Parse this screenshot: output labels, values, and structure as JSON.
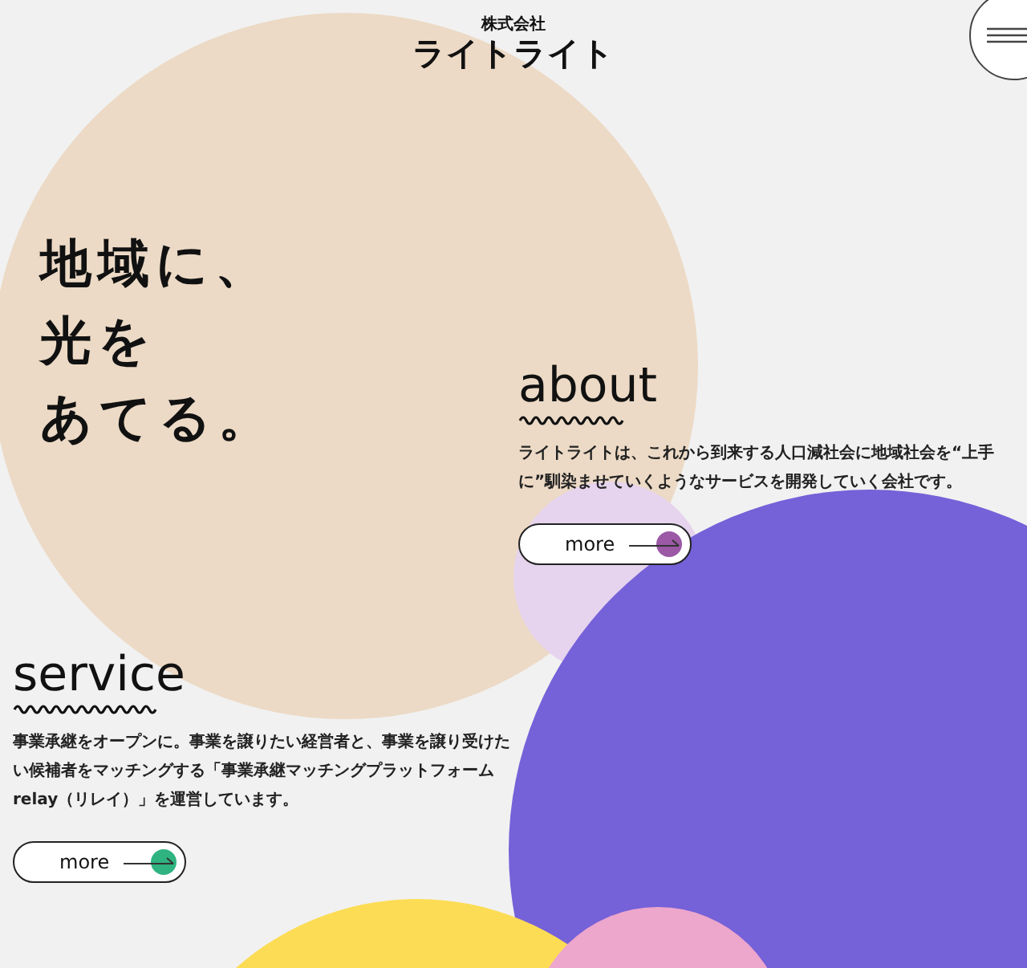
{
  "logo": {
    "caption": "株式会社",
    "name": "ライトライト"
  },
  "hero": {
    "lines": [
      "地域に、",
      "光を",
      "あてる。"
    ]
  },
  "sections": [
    {
      "title": "about",
      "text": "ライトライトは、これから到来する人口減社会に地域社会を“上手に”馴染ませていくようなサービスを開発していく会社です。",
      "button": {
        "label": "more",
        "color": "#9b59a6"
      }
    },
    {
      "title": "service",
      "text": "事業承継をオープンに。事業を譲りたい経営者と、事業を譲り受けたい候補者をマッチングする「事業承継マッチングプラットフォームrelay（リレイ）」を運営しています。",
      "button": {
        "label": "more",
        "color": "#2fb380"
      }
    }
  ]
}
